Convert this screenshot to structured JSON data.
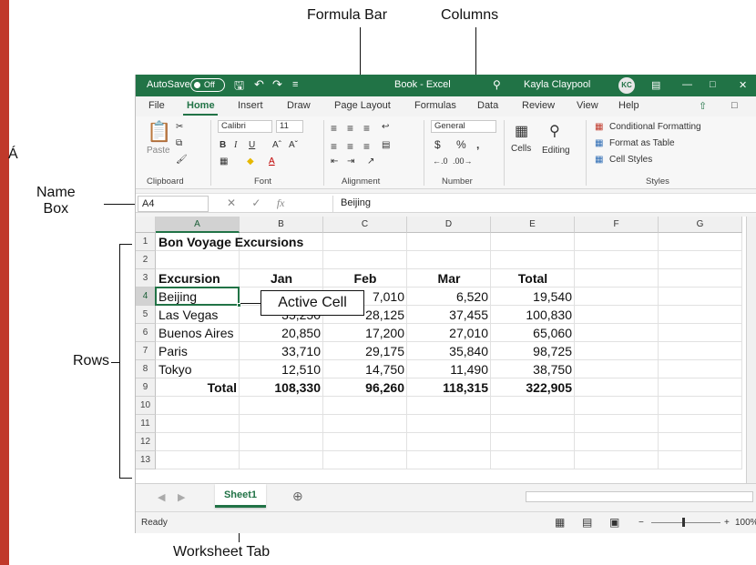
{
  "callouts": {
    "formula_bar": "Formula Bar",
    "columns": "Columns",
    "name_box_line1": "Name",
    "name_box_line2": "Box",
    "rows": "Rows",
    "active_cell": "Active Cell",
    "worksheet_tab": "Worksheet Tab",
    "stray_char": "Á"
  },
  "titlebar": {
    "autosave": "AutoSave",
    "autosave_state": "Off",
    "title": "Book - Excel",
    "user": "Kayla Claypool",
    "initials": "KC"
  },
  "menu": [
    "File",
    "Home",
    "Insert",
    "Draw",
    "Page Layout",
    "Formulas",
    "Data",
    "Review",
    "View",
    "Help"
  ],
  "ribbon": {
    "paste": "Paste",
    "font_name": "Calibri",
    "font_size": "11",
    "number_format": "General",
    "cells": "Cells",
    "editing": "Editing",
    "conditional_formatting": "Conditional Formatting",
    "format_as_table": "Format as Table",
    "cell_styles": "Cell Styles",
    "groups": [
      "Clipboard",
      "Font",
      "Alignment",
      "Number",
      "Styles"
    ]
  },
  "formula_bar": {
    "name_box": "A4",
    "value": "Beijing"
  },
  "columns": [
    "A",
    "B",
    "C",
    "D",
    "E",
    "F",
    "G"
  ],
  "rows": [
    "1",
    "2",
    "3",
    "4",
    "5",
    "6",
    "7",
    "8",
    "9",
    "10",
    "11",
    "12",
    "13"
  ],
  "sheet": {
    "title": "Bon Voyage Excursions",
    "headers": [
      "Excursion",
      "Jan",
      "Feb",
      "Mar",
      "Total"
    ],
    "data": [
      [
        "Beijing",
        "",
        "7,010",
        "6,520",
        "19,540"
      ],
      [
        "Las Vegas",
        "35,250",
        "28,125",
        "37,455",
        "100,830"
      ],
      [
        "Buenos Aires",
        "20,850",
        "17,200",
        "27,010",
        "65,060"
      ],
      [
        "Paris",
        "33,710",
        "29,175",
        "35,840",
        "98,725"
      ],
      [
        "Tokyo",
        "12,510",
        "14,750",
        "11,490",
        "38,750"
      ]
    ],
    "total_row": [
      "Total",
      "108,330",
      "96,260",
      "118,315",
      "322,905"
    ]
  },
  "sheet_tab": "Sheet1",
  "status": {
    "ready": "Ready",
    "zoom": "100%"
  },
  "colors": {
    "accent": "#217346",
    "left_rule": "#c0392b"
  }
}
